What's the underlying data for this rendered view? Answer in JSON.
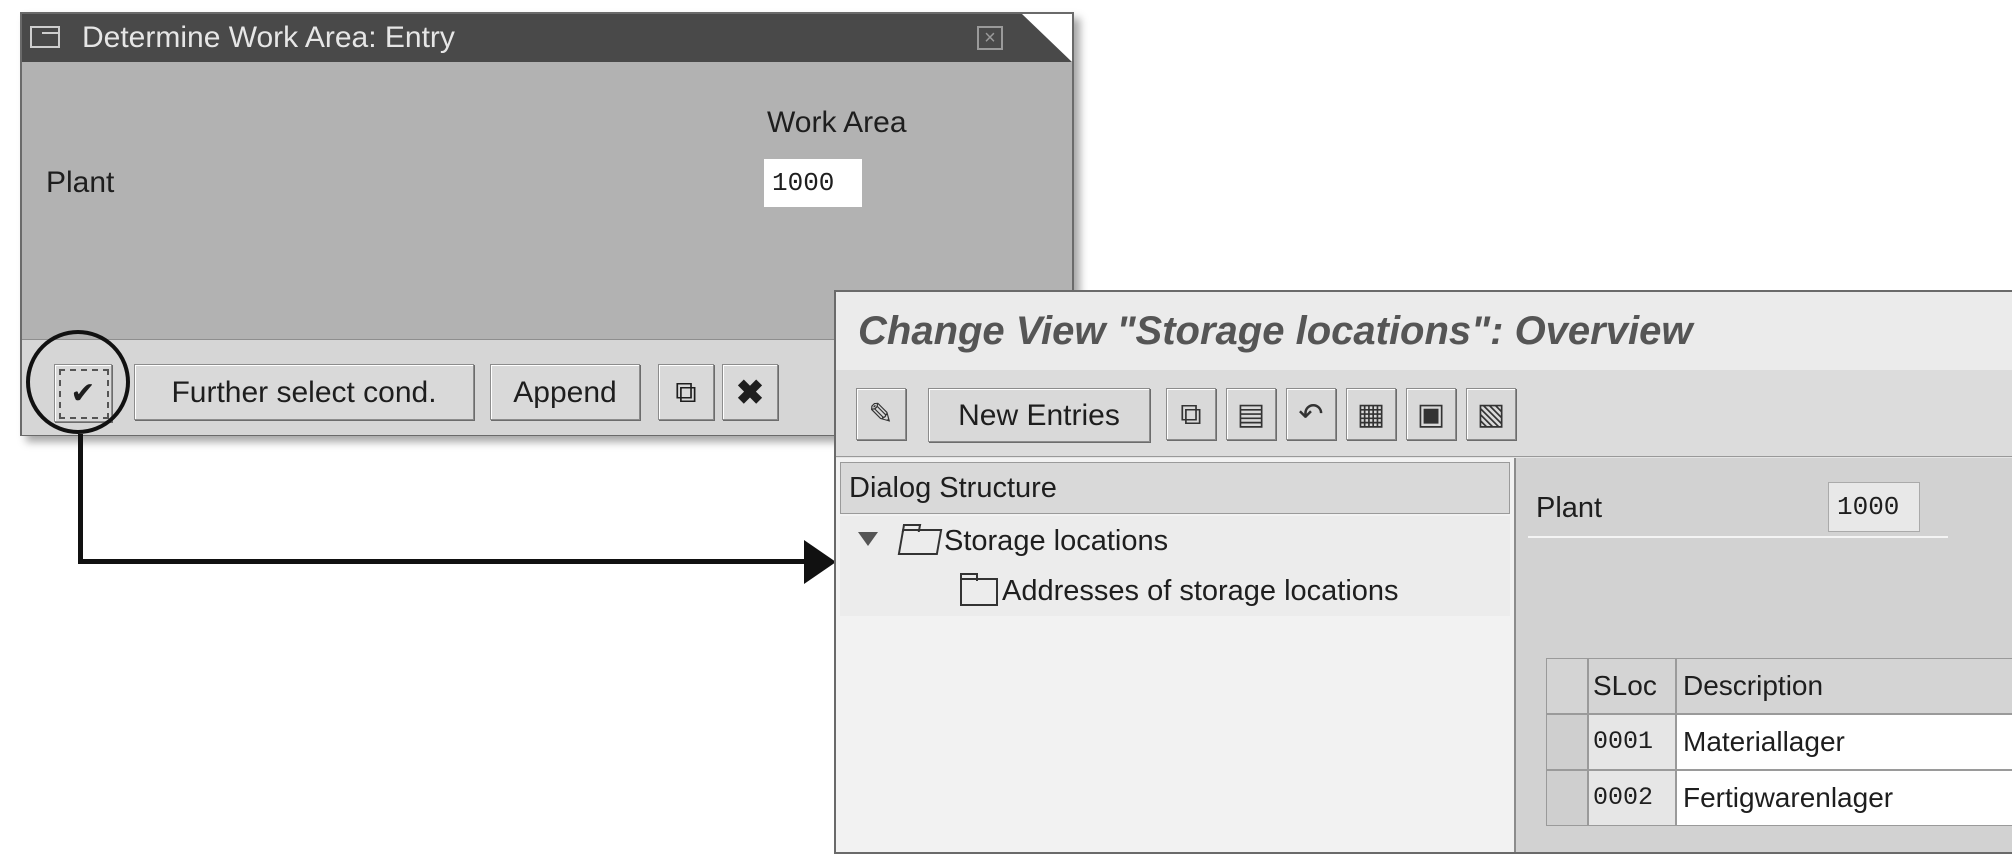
{
  "dialog1": {
    "title": "Determine Work Area: Entry",
    "work_area_header": "Work Area",
    "plant_label": "Plant",
    "plant_value": "1000",
    "buttons": {
      "further": "Further select cond.",
      "append": "Append"
    }
  },
  "window2": {
    "title": "Change View \"Storage locations\": Overview",
    "toolbar": {
      "new_entries": "New Entries"
    },
    "dialog_structure": {
      "header": "Dialog Structure",
      "items": [
        "Storage locations",
        "Addresses of storage locations"
      ]
    },
    "plant_label": "Plant",
    "plant_value": "1000",
    "table": {
      "headers": [
        "SLoc",
        "Description"
      ],
      "rows": [
        {
          "sloc": "0001",
          "description": "Materiallager"
        },
        {
          "sloc": "0002",
          "description": "Fertigwarenlager"
        }
      ]
    }
  },
  "icons": [
    "window-icon",
    "close-icon",
    "check-icon",
    "append-icon",
    "cancel-icon",
    "display-change-icon",
    "copy-icon",
    "delete-icon",
    "undo-icon",
    "select-all-icon",
    "select-block-icon",
    "deselect-icon"
  ]
}
